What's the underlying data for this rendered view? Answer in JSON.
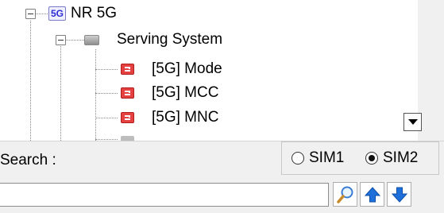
{
  "tree": {
    "root": {
      "badge": "5G",
      "label": "NR 5G"
    },
    "group": {
      "label": "Serving System"
    },
    "items": [
      {
        "label": "[5G] Mode"
      },
      {
        "label": "[5G] MCC"
      },
      {
        "label": "[5G] MNC"
      }
    ]
  },
  "search": {
    "label": "Search :",
    "value": "",
    "placeholder": ""
  },
  "sim": {
    "options": [
      {
        "label": "SIM1",
        "checked": false
      },
      {
        "label": "SIM2",
        "checked": true
      }
    ]
  },
  "toolbar": {
    "icons": [
      "search-icon",
      "arrow-up-icon",
      "arrow-down-icon"
    ]
  },
  "colors": {
    "item_icon": "#e64141",
    "nav_arrow": "#1e6fd9",
    "panel_bg": "#f0f0f0"
  }
}
